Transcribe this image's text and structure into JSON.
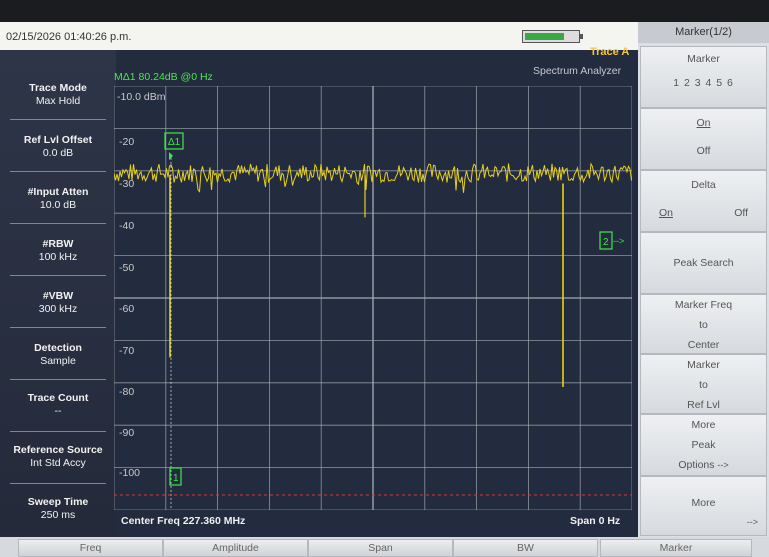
{
  "status": {
    "timestamp": "02/15/2026 01:40:26 p.m.",
    "trace_label": "Trace A",
    "mode_label": "Spectrum Analyzer",
    "battery_level": 0.75,
    "battery_color": "#39a845"
  },
  "marker_readout": "MΔ1 80.24dB @0 Hz",
  "ref_level_text": "-10.0 dBm",
  "left_panel": [
    {
      "title": "Trace Mode",
      "value": "Max Hold"
    },
    {
      "title": "Ref Lvl Offset",
      "value": "0.0 dB"
    },
    {
      "title": "#Input Atten",
      "value": "10.0 dB"
    },
    {
      "title": "#RBW",
      "value": "100 kHz"
    },
    {
      "title": "#VBW",
      "value": "300 kHz"
    },
    {
      "title": "Detection",
      "value": "Sample"
    },
    {
      "title": "Trace Count",
      "value": "--"
    },
    {
      "title": "Reference Source",
      "value": "Int Std Accy"
    },
    {
      "title": "Sweep Time",
      "value": "250 ms"
    }
  ],
  "y_axis": {
    "labels": [
      "-20",
      "-30",
      "-40",
      "-50",
      "-60",
      "-70",
      "-80",
      "-90",
      "-100"
    ]
  },
  "center_freq": "Center Freq 227.360 MHz",
  "span": "Span 0 Hz",
  "markers": {
    "delta1_label": "Δ1",
    "m1_label": "1",
    "m2_label": "2",
    "arrow": "-->"
  },
  "right_panel": {
    "title": "Marker(1/2)",
    "keys": {
      "marker": {
        "title": "Marker",
        "options": "1 2 3 4 5 6",
        "selected": "1"
      },
      "on_off": {
        "on": "On",
        "off": "Off"
      },
      "delta": {
        "title": "Delta",
        "on": "On",
        "off": "Off"
      },
      "peak_search": "Peak Search",
      "marker_freq": [
        "Marker Freq",
        "to",
        "Center"
      ],
      "marker_ref": [
        "Marker",
        "to",
        "Ref Lvl"
      ],
      "more_peak": [
        "More",
        "Peak",
        "Options"
      ],
      "more_peak_arrow": "-->",
      "more": "More",
      "more_arrow": "-->"
    }
  },
  "bottom_softkeys": [
    "Freq",
    "Amplitude",
    "Span",
    "BW",
    "Marker"
  ],
  "colors": {
    "trace": "#e6d21c",
    "marker": "#3fe84a",
    "grid": "#a9adb6",
    "screen": "#232b3e"
  }
}
